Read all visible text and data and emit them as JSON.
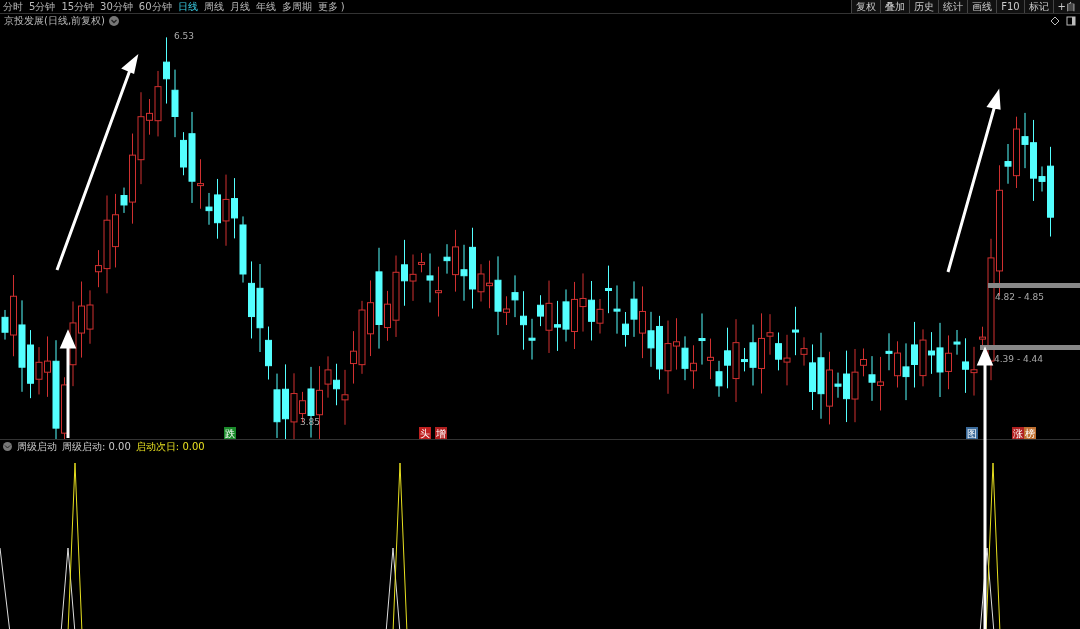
{
  "periods": [
    {
      "label": "分时",
      "selected": false
    },
    {
      "label": "5分钟",
      "selected": false
    },
    {
      "label": "15分钟",
      "selected": false
    },
    {
      "label": "30分钟",
      "selected": false
    },
    {
      "label": "60分钟",
      "selected": false
    },
    {
      "label": "日线",
      "selected": true
    },
    {
      "label": "周线",
      "selected": false
    },
    {
      "label": "月线",
      "selected": false
    },
    {
      "label": "年线",
      "selected": false
    },
    {
      "label": "多周期",
      "selected": false
    },
    {
      "label": "更多 )",
      "selected": false
    }
  ],
  "tools": [
    "复权",
    "叠加",
    "历史",
    "统计",
    "画线",
    "F10",
    "标记",
    "+自"
  ],
  "chart_title": "京投发展(日线,前复权)",
  "price_labels": [
    {
      "kind": "high",
      "text": "6.53"
    },
    {
      "kind": "low",
      "text": "3.85"
    }
  ],
  "zones": [
    {
      "text": "4.82 - 4.85"
    },
    {
      "text": "4.39 - 4.44"
    }
  ],
  "events": [
    {
      "text": "跌",
      "color": "#1a8a2a"
    },
    {
      "text": "头",
      "color": "#c02020"
    },
    {
      "text": "增",
      "color": "#b02020"
    },
    {
      "text": "图",
      "color": "#3a6a9a"
    },
    {
      "text": "涨",
      "color": "#b02020"
    },
    {
      "text": "榜",
      "color": "#c07030"
    }
  ],
  "indicator": {
    "name": "周级启动",
    "values": [
      {
        "label": "周级启动: 0.00",
        "kind": "white"
      },
      {
        "label": "启动次日: 0.00",
        "kind": "yellow"
      }
    ]
  }
}
